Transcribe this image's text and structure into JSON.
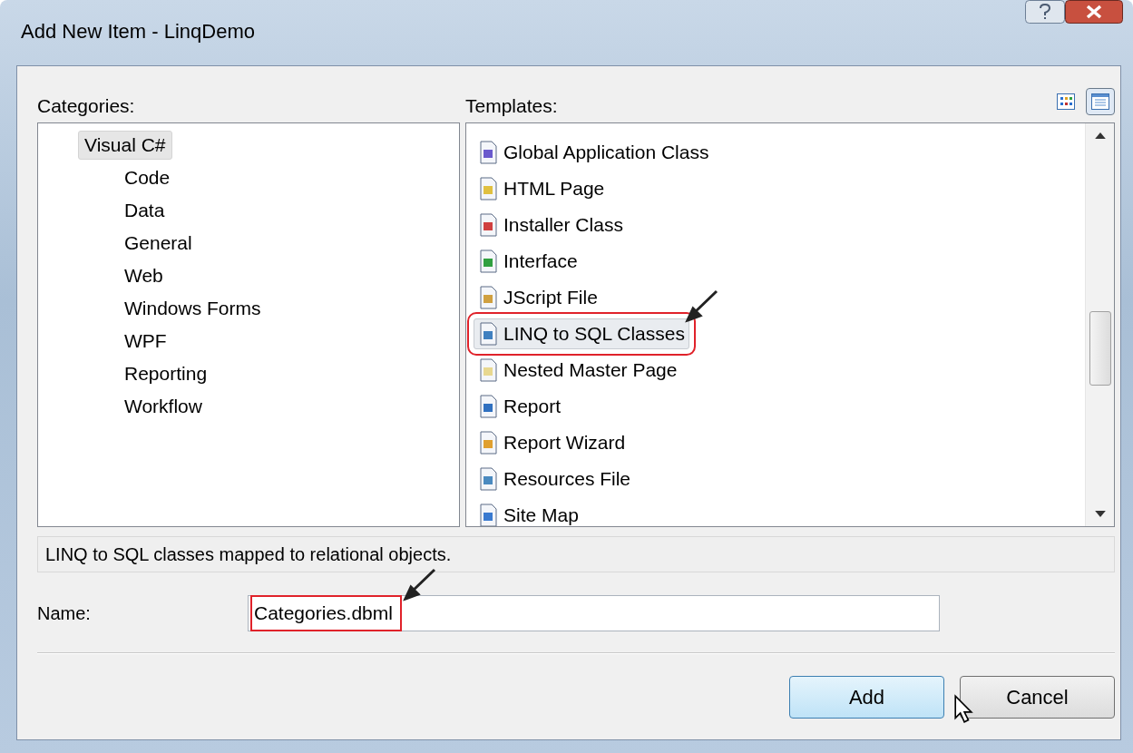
{
  "window": {
    "title": "Add New Item - LinqDemo"
  },
  "categories": {
    "label": "Categories:",
    "items": [
      {
        "label": "Visual C#",
        "selected": true,
        "children": [
          {
            "label": "Code",
            "selected": false
          },
          {
            "label": "Data",
            "selected": false
          },
          {
            "label": "General",
            "selected": false
          },
          {
            "label": "Web",
            "selected": false
          },
          {
            "label": "Windows Forms",
            "selected": false
          },
          {
            "label": "WPF",
            "selected": false
          },
          {
            "label": "Reporting",
            "selected": false
          },
          {
            "label": "Workflow",
            "selected": false
          }
        ]
      }
    ]
  },
  "templates": {
    "label": "Templates:",
    "view_toggle": [
      {
        "kind": "icons",
        "selected": false
      },
      {
        "kind": "list",
        "selected": true
      }
    ],
    "items": [
      {
        "label": "Global Application Class",
        "selected": false
      },
      {
        "label": "HTML Page",
        "selected": false
      },
      {
        "label": "Installer Class",
        "selected": false
      },
      {
        "label": "Interface",
        "selected": false
      },
      {
        "label": "JScript File",
        "selected": false
      },
      {
        "label": "LINQ to SQL Classes",
        "selected": true
      },
      {
        "label": "Nested Master Page",
        "selected": false
      },
      {
        "label": "Report",
        "selected": false
      },
      {
        "label": "Report Wizard",
        "selected": false
      },
      {
        "label": "Resources File",
        "selected": false
      },
      {
        "label": "Site Map",
        "selected": false
      }
    ]
  },
  "description": "LINQ to SQL classes mapped to relational objects.",
  "name": {
    "label": "Name:",
    "value": "Categories.dbml",
    "highlighted": true
  },
  "buttons": [
    {
      "label": "Add",
      "kind": "default"
    },
    {
      "label": "Cancel",
      "kind": "normal"
    }
  ]
}
